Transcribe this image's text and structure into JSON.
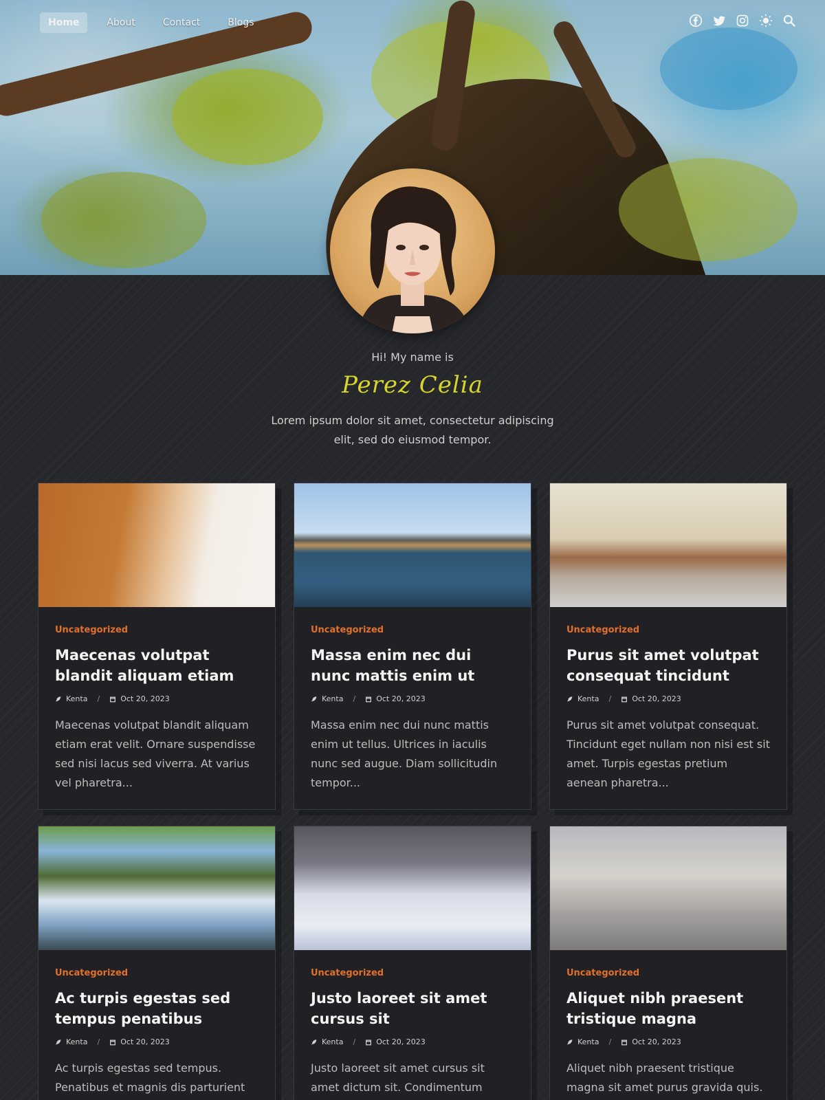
{
  "nav": {
    "items": [
      {
        "label": "Home",
        "active": true
      },
      {
        "label": "About",
        "active": false
      },
      {
        "label": "Contact",
        "active": false
      },
      {
        "label": "Blogs",
        "active": false
      }
    ]
  },
  "header_icons": [
    "facebook-icon",
    "twitter-icon",
    "instagram-icon",
    "theme-toggle-icon",
    "search-icon"
  ],
  "profile": {
    "greeting": "Hi! My name is",
    "name": "Perez Celia",
    "bio": "Lorem ipsum dolor sit amet, consectetur adipiscing elit, sed do eiusmod tempor."
  },
  "colors": {
    "accent_category": "#e0702a",
    "name_color": "#d7d52a",
    "background": "#26272b",
    "card_background": "#212125"
  },
  "posts": [
    {
      "category": "Uncategorized",
      "title": "Maecenas volutpat blandit aliquam etiam",
      "author": "Kenta",
      "date": "Oct 20, 2023",
      "excerpt": "Maecenas volutpat blandit aliquam etiam erat velit. Ornare suspendisse sed nisi lacus sed viverra. At varius vel pharetra...",
      "image": "grass-painting"
    },
    {
      "category": "Uncategorized",
      "title": "Massa enim nec dui nunc mattis enim ut",
      "author": "Kenta",
      "date": "Oct 20, 2023",
      "excerpt": "Massa enim nec dui nunc mattis enim ut tellus. Ultrices in iaculis nunc sed augue. Diam sollicitudin tempor...",
      "image": "lake-painting"
    },
    {
      "category": "Uncategorized",
      "title": "Purus sit amet volutpat consequat tincidunt",
      "author": "Kenta",
      "date": "Oct 20, 2023",
      "excerpt": "Purus sit amet volutpat consequat. Tincidunt eget nullam non nisi est sit amet. Turpis egestas pretium aenean pharetra...",
      "image": "bare-trees-painting"
    },
    {
      "category": "Uncategorized",
      "title": "Ac turpis egestas sed tempus penatibus",
      "author": "Kenta",
      "date": "Oct 20, 2023",
      "excerpt": "Ac turpis egestas sed tempus. Penatibus et magnis dis parturient",
      "image": "waterfall-painting"
    },
    {
      "category": "Uncategorized",
      "title": "Justo laoreet sit amet cursus sit",
      "author": "Kenta",
      "date": "Oct 20, 2023",
      "excerpt": "Justo laoreet sit amet cursus sit amet dictum sit. Condimentum",
      "image": "arctic-fox-painting"
    },
    {
      "category": "Uncategorized",
      "title": "Aliquet nibh praesent tristique magna",
      "author": "Kenta",
      "date": "Oct 20, 2023",
      "excerpt": "Aliquet nibh praesent tristique magna sit amet purus gravida quis.",
      "image": "husky-painting"
    }
  ]
}
